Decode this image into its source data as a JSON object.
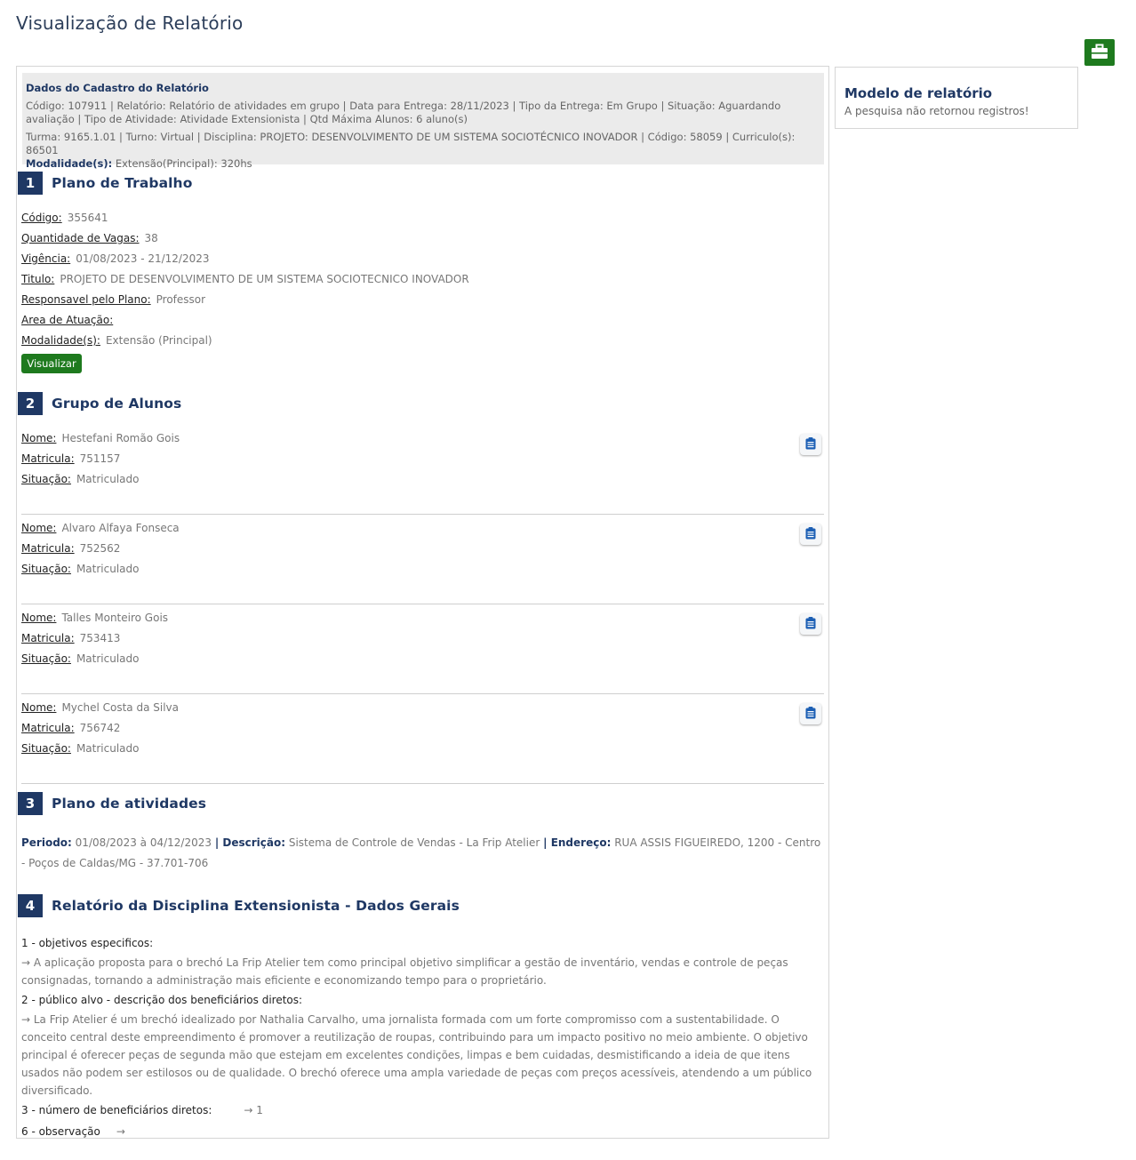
{
  "page_title": "Visualização de Relatório",
  "header": {
    "title": "Dados do Cadastro do Relatório",
    "line1": "Código: 107911    | Relatório: Relatório de atividades em grupo    | Data para Entrega: 28/11/2023    | Tipo da Entrega: Em Grupo    | Situação: Aguardando avaliação    | Tipo de Atividade: Atividade Extensionista    | Qtd Máxima Alunos: 6 aluno(s)",
    "line2": "Turma: 9165.1.01 | Turno: Virtual    | Disciplina: PROJETO: DESENVOLVIMENTO DE UM SISTEMA SOCIOTÉCNICO INOVADOR | Código: 58059    | Curriculo(s): 86501",
    "modalidade_label": "Modalidade(s):",
    "modalidade_value": "Extensão(Principal): 320hs"
  },
  "sections": {
    "s1": {
      "num": "1",
      "title": "Plano de Trabalho"
    },
    "s2": {
      "num": "2",
      "title": "Grupo de Alunos"
    },
    "s3": {
      "num": "3",
      "title": "Plano de atividades"
    },
    "s4": {
      "num": "4",
      "title": "Relatório da Disciplina Extensionista - Dados Gerais"
    }
  },
  "plano": {
    "codigo_label": "Código:",
    "codigo": "355641",
    "vagas_label": "Quantidade de Vagas:",
    "vagas": "38",
    "vigencia_label": "Vigência:",
    "vigencia": "01/08/2023 - 21/12/2023",
    "titulo_label": "Titulo:",
    "titulo": "PROJETO DE DESENVOLVIMENTO DE UM SISTEMA SOCIOTECNICO INOVADOR",
    "responsavel_label": "Responsavel pelo Plano:",
    "responsavel": "Professor",
    "area_label": "Area de Atuação:",
    "area": "",
    "modalidade_label": "Modalidade(s):",
    "modalidade": "Extensão (Principal)",
    "visualizar": "Visualizar"
  },
  "alunos": [
    {
      "nome_label": "Nome:",
      "nome": "Hestefani Romão Gois",
      "mat_label": "Matricula:",
      "matricula": "751157",
      "sit_label": "Situação:",
      "situacao": "Matriculado"
    },
    {
      "nome_label": "Nome:",
      "nome": "Alvaro Alfaya Fonseca",
      "mat_label": "Matricula:",
      "matricula": "752562",
      "sit_label": "Situação:",
      "situacao": "Matriculado"
    },
    {
      "nome_label": "Nome:",
      "nome": "Talles Monteiro Gois",
      "mat_label": "Matricula:",
      "matricula": "753413",
      "sit_label": "Situação:",
      "situacao": "Matriculado"
    },
    {
      "nome_label": "Nome:",
      "nome": "Mychel Costa da Silva",
      "mat_label": "Matricula:",
      "matricula": "756742",
      "sit_label": "Situação:",
      "situacao": "Matriculado"
    }
  ],
  "atividades": {
    "periodo_label": "Periodo:",
    "periodo": "01/08/2023 à 04/12/2023",
    "descricao_label": "Descrição:",
    "descricao": "Sistema de Controle de Vendas - La Frip Atelier",
    "endereco_label": "Endereço:",
    "endereco": "RUA ASSIS FIGUEIREDO, 1200 - Centro - Poços de Caldas/MG - 37.701-706"
  },
  "relatorio": {
    "q1": "1 - objetivos especificos:",
    "a1": "→ A aplicação proposta para o brechó La Frip Atelier tem como principal objetivo simplificar a gestão de inventário, vendas e controle de peças consignadas, tornando a administração mais eficiente e economizando tempo para o proprietário.",
    "q2": "2 - público alvo - descrição dos beneficiários diretos:",
    "a2": "→ La Frip Atelier é um brechó idealizado por Nathalia Carvalho, uma jornalista formada com um forte compromisso com a sustentabilidade. O conceito central deste empreendimento é promover a reutilização de roupas, contribuindo para um impacto positivo no meio ambiente. O objetivo principal é oferecer peças de segunda mão que estejam em excelentes condições, limpas e bem cuidadas, desmistificando a ideia de que itens usados não podem ser estilosos ou de qualidade. O brechó oferece uma ampla variedade de peças com preços acessíveis, atendendo a um público diversificado.",
    "q3": "3 - número de beneficiários diretos:",
    "a3": "→ 1",
    "q6": "6 - observação",
    "a6": "→"
  },
  "side": {
    "title": "Modelo de relatório",
    "empty": "A pesquisa não retornou registros!"
  },
  "icons": {
    "corner": "briefcase-icon",
    "student_action": "clipboard-icon"
  },
  "colors": {
    "accent": "#1f3864",
    "button_green": "#1e7a1e"
  }
}
